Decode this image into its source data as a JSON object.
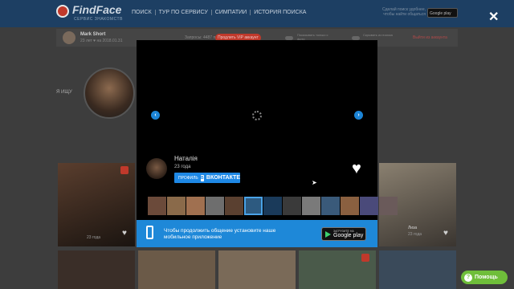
{
  "header": {
    "logo_text": "FindFace",
    "logo_subtitle": "СЕРВИС ЗНАКОМСТВ",
    "nav": [
      "ПОИСК",
      "ТУР ПО СЕРВИСУ",
      "СИМПАТИИ",
      "ИСТОРИЯ ПОИСКА"
    ],
    "promo_text": "Сделай поиск удобнее, чтобы найти общаться",
    "gplay_label": "Google play",
    "close_symbol": "✕"
  },
  "user_bar": {
    "name": "Mark Short",
    "info": "23 лет ♥ на 2018.01.31",
    "requests_label": "Запросы: 4487 поисков",
    "vip_label": "Продлить VIP аккаунт",
    "toggle1_label": "Показывать только с фото",
    "toggle2_label": "Скрывать из поиска",
    "logout_label": "Выйти из аккаунта"
  },
  "page": {
    "looking_label": "Я ИЩУ",
    "cards": [
      {
        "name": "",
        "age": "23 года"
      },
      {
        "name": "Лиза",
        "age": "23 года"
      }
    ]
  },
  "profile": {
    "name": "Наталія",
    "age": "23 года",
    "vk_button_prefix": "ПРОФИЛЬ",
    "vk_button_brand": "ВКОНТАКТЕ",
    "thumbnails": [
      "#6b4a3a",
      "#8a6a4a",
      "#a07050",
      "#6e6e6e",
      "#5a4030",
      "#2d5a80",
      "#1a3a5a",
      "#3a3a3a",
      "#7a7a7a",
      "#3a5a7a",
      "#8a6040",
      "#4a4a7a",
      "#6a5a5a"
    ],
    "selected_thumbnail_index": 5
  },
  "banner": {
    "text": "Чтобы продолжить общение установите наше мобильное приложение",
    "gplay_small": "ЗАГРУЗИТЕ НА",
    "gplay_big": "Google play"
  },
  "help": {
    "label": "Помощь",
    "icon_symbol": "?"
  },
  "colors": {
    "header_bg": "#1d3f63",
    "vk_blue": "#1e88e5",
    "help_green": "#6fbe3a",
    "vip_red": "#c0392b"
  }
}
